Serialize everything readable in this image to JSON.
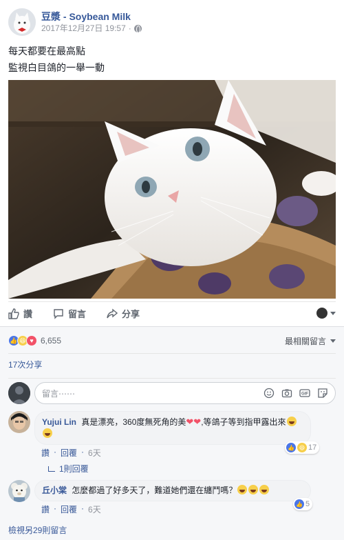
{
  "post": {
    "page_name": "豆漿 - Soybean Milk",
    "timestamp": "2017年12月27日 19:57",
    "meta_separator": "·",
    "text_line1": "每天都要在最高點",
    "text_line2": "監視白目鴿的一舉一動"
  },
  "actions": {
    "like_label": "讚",
    "comment_label": "留言",
    "share_label": "分享"
  },
  "reactions": {
    "count": "6,655",
    "types": [
      "like-icon",
      "haha-icon",
      "love-icon"
    ],
    "sort_label": "最相關留言"
  },
  "shares": {
    "label": "17次分享"
  },
  "composer": {
    "placeholder": "留言⋯⋯"
  },
  "comments": [
    {
      "author": "Yujui Lin",
      "text_part1": "真是漂亮，360度無死角的美",
      "text_part2": ",等鴿子等到指甲露出來",
      "like_label": "讚",
      "reply_label": "回覆",
      "time": "6天",
      "reaction_count": "17",
      "replies_label": "1則回覆"
    },
    {
      "author": "丘小棠",
      "text": "怎麼都過了好多天了，難道她們還在纏鬥嗎？",
      "like_label": "讚",
      "reply_label": "回覆",
      "time": "6天",
      "reaction_count": "5"
    }
  ],
  "more_comments": {
    "label": "檢視另29則留言"
  },
  "colors": {
    "link_blue": "#365899",
    "meta_gray": "#90949c",
    "like_blue": "#4a76e8",
    "love_red": "#f25268",
    "haha_yellow": "#f7cf4a"
  }
}
